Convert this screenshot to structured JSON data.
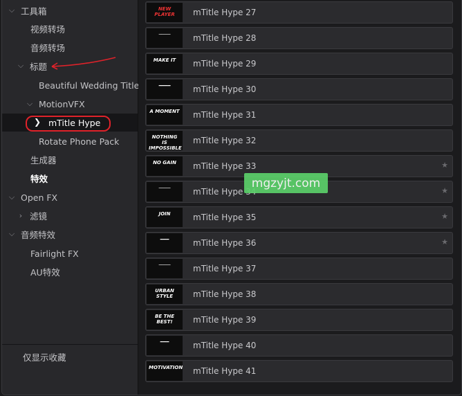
{
  "sidebar": {
    "toolbox": "工具箱",
    "video_transitions": "视频转场",
    "audio_transitions": "音频转场",
    "titles": "标题",
    "beautiful_wedding": "Beautiful Wedding Titles",
    "motionvfx": "MotionVFX",
    "mtitle_hype": "mTitle Hype",
    "rotate_phone": "Rotate Phone Pack",
    "generators": "生成器",
    "effects": "特效",
    "open_fx": "Open FX",
    "filters": "滤镜",
    "audio_fx": "音频特效",
    "fairlight_fx": "Fairlight FX",
    "au_effects": "AU特效",
    "favorites_only": "仅显示收藏"
  },
  "items": [
    {
      "name": "mTitle Hype 27",
      "thumb": "NEW PLAYER",
      "starred": false
    },
    {
      "name": "mTitle Hype 28",
      "thumb": "────",
      "starred": false
    },
    {
      "name": "mTitle Hype 29",
      "thumb": "MAKE IT",
      "starred": false
    },
    {
      "name": "mTitle Hype 30",
      "thumb": "━━━━",
      "starred": false
    },
    {
      "name": "mTitle Hype 31",
      "thumb": "A MOMENT",
      "starred": false
    },
    {
      "name": "mTitle Hype 32",
      "thumb": "NOTHING IS IMPOSSIBLE",
      "starred": false
    },
    {
      "name": "mTitle Hype 33",
      "thumb": "NO GAIN",
      "starred": true
    },
    {
      "name": "mTitle Hype 34",
      "thumb": "────",
      "starred": true
    },
    {
      "name": "mTitle Hype 35",
      "thumb": "JOIN",
      "starred": true
    },
    {
      "name": "mTitle Hype 36",
      "thumb": "━━━",
      "starred": true
    },
    {
      "name": "mTitle Hype 37",
      "thumb": "────",
      "starred": false
    },
    {
      "name": "mTitle Hype 38",
      "thumb": "URBAN STYLE",
      "starred": false
    },
    {
      "name": "mTitle Hype 39",
      "thumb": "BE THE BEST!",
      "starred": false
    },
    {
      "name": "mTitle Hype 40",
      "thumb": "━━━",
      "starred": false
    },
    {
      "name": "mTitle Hype 41",
      "thumb": "MOTIVATION",
      "starred": false
    }
  ],
  "watermark": "mgzyjt.com",
  "icons": {
    "expanded": "chevron-down-icon",
    "collapsed": "chevron-right-icon",
    "favorite": "star-icon"
  },
  "colors": {
    "selection_outline": "#e0222a",
    "annotation_arrow": "#e0222a",
    "watermark_bg": "#5bd06a"
  }
}
